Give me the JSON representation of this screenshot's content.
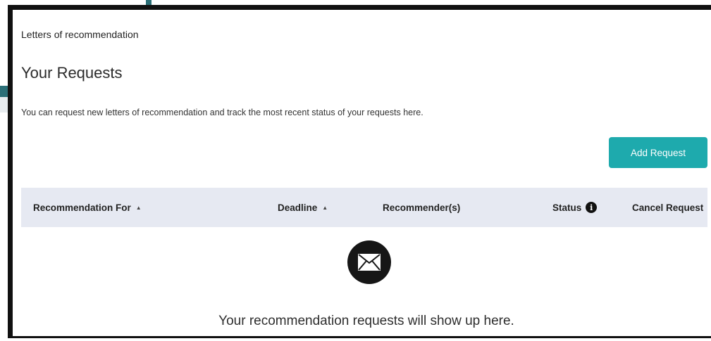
{
  "breadcrumb": "Letters of recommendation",
  "page": {
    "title": "Your Requests",
    "description": "You can request new letters of recommendation and track the most recent status of your requests here."
  },
  "toolbar": {
    "add_label": "Add Request"
  },
  "table": {
    "columns": [
      {
        "label": "Recommendation For",
        "sortable": true
      },
      {
        "label": "Deadline",
        "sortable": true
      },
      {
        "label": "Recommender(s)",
        "sortable": false
      },
      {
        "label": "Status",
        "sortable": false,
        "info": true
      },
      {
        "label": "Cancel Request",
        "sortable": false
      }
    ],
    "rows": []
  },
  "empty_state": {
    "icon": "envelope-icon",
    "message": "Your recommendation requests will show up here."
  },
  "colors": {
    "accent": "#1eaaad",
    "header_bg": "#e6e9f2",
    "frame": "#111111"
  },
  "icons": {
    "sort": "sort-caret-icon",
    "status_info": "info-icon"
  }
}
